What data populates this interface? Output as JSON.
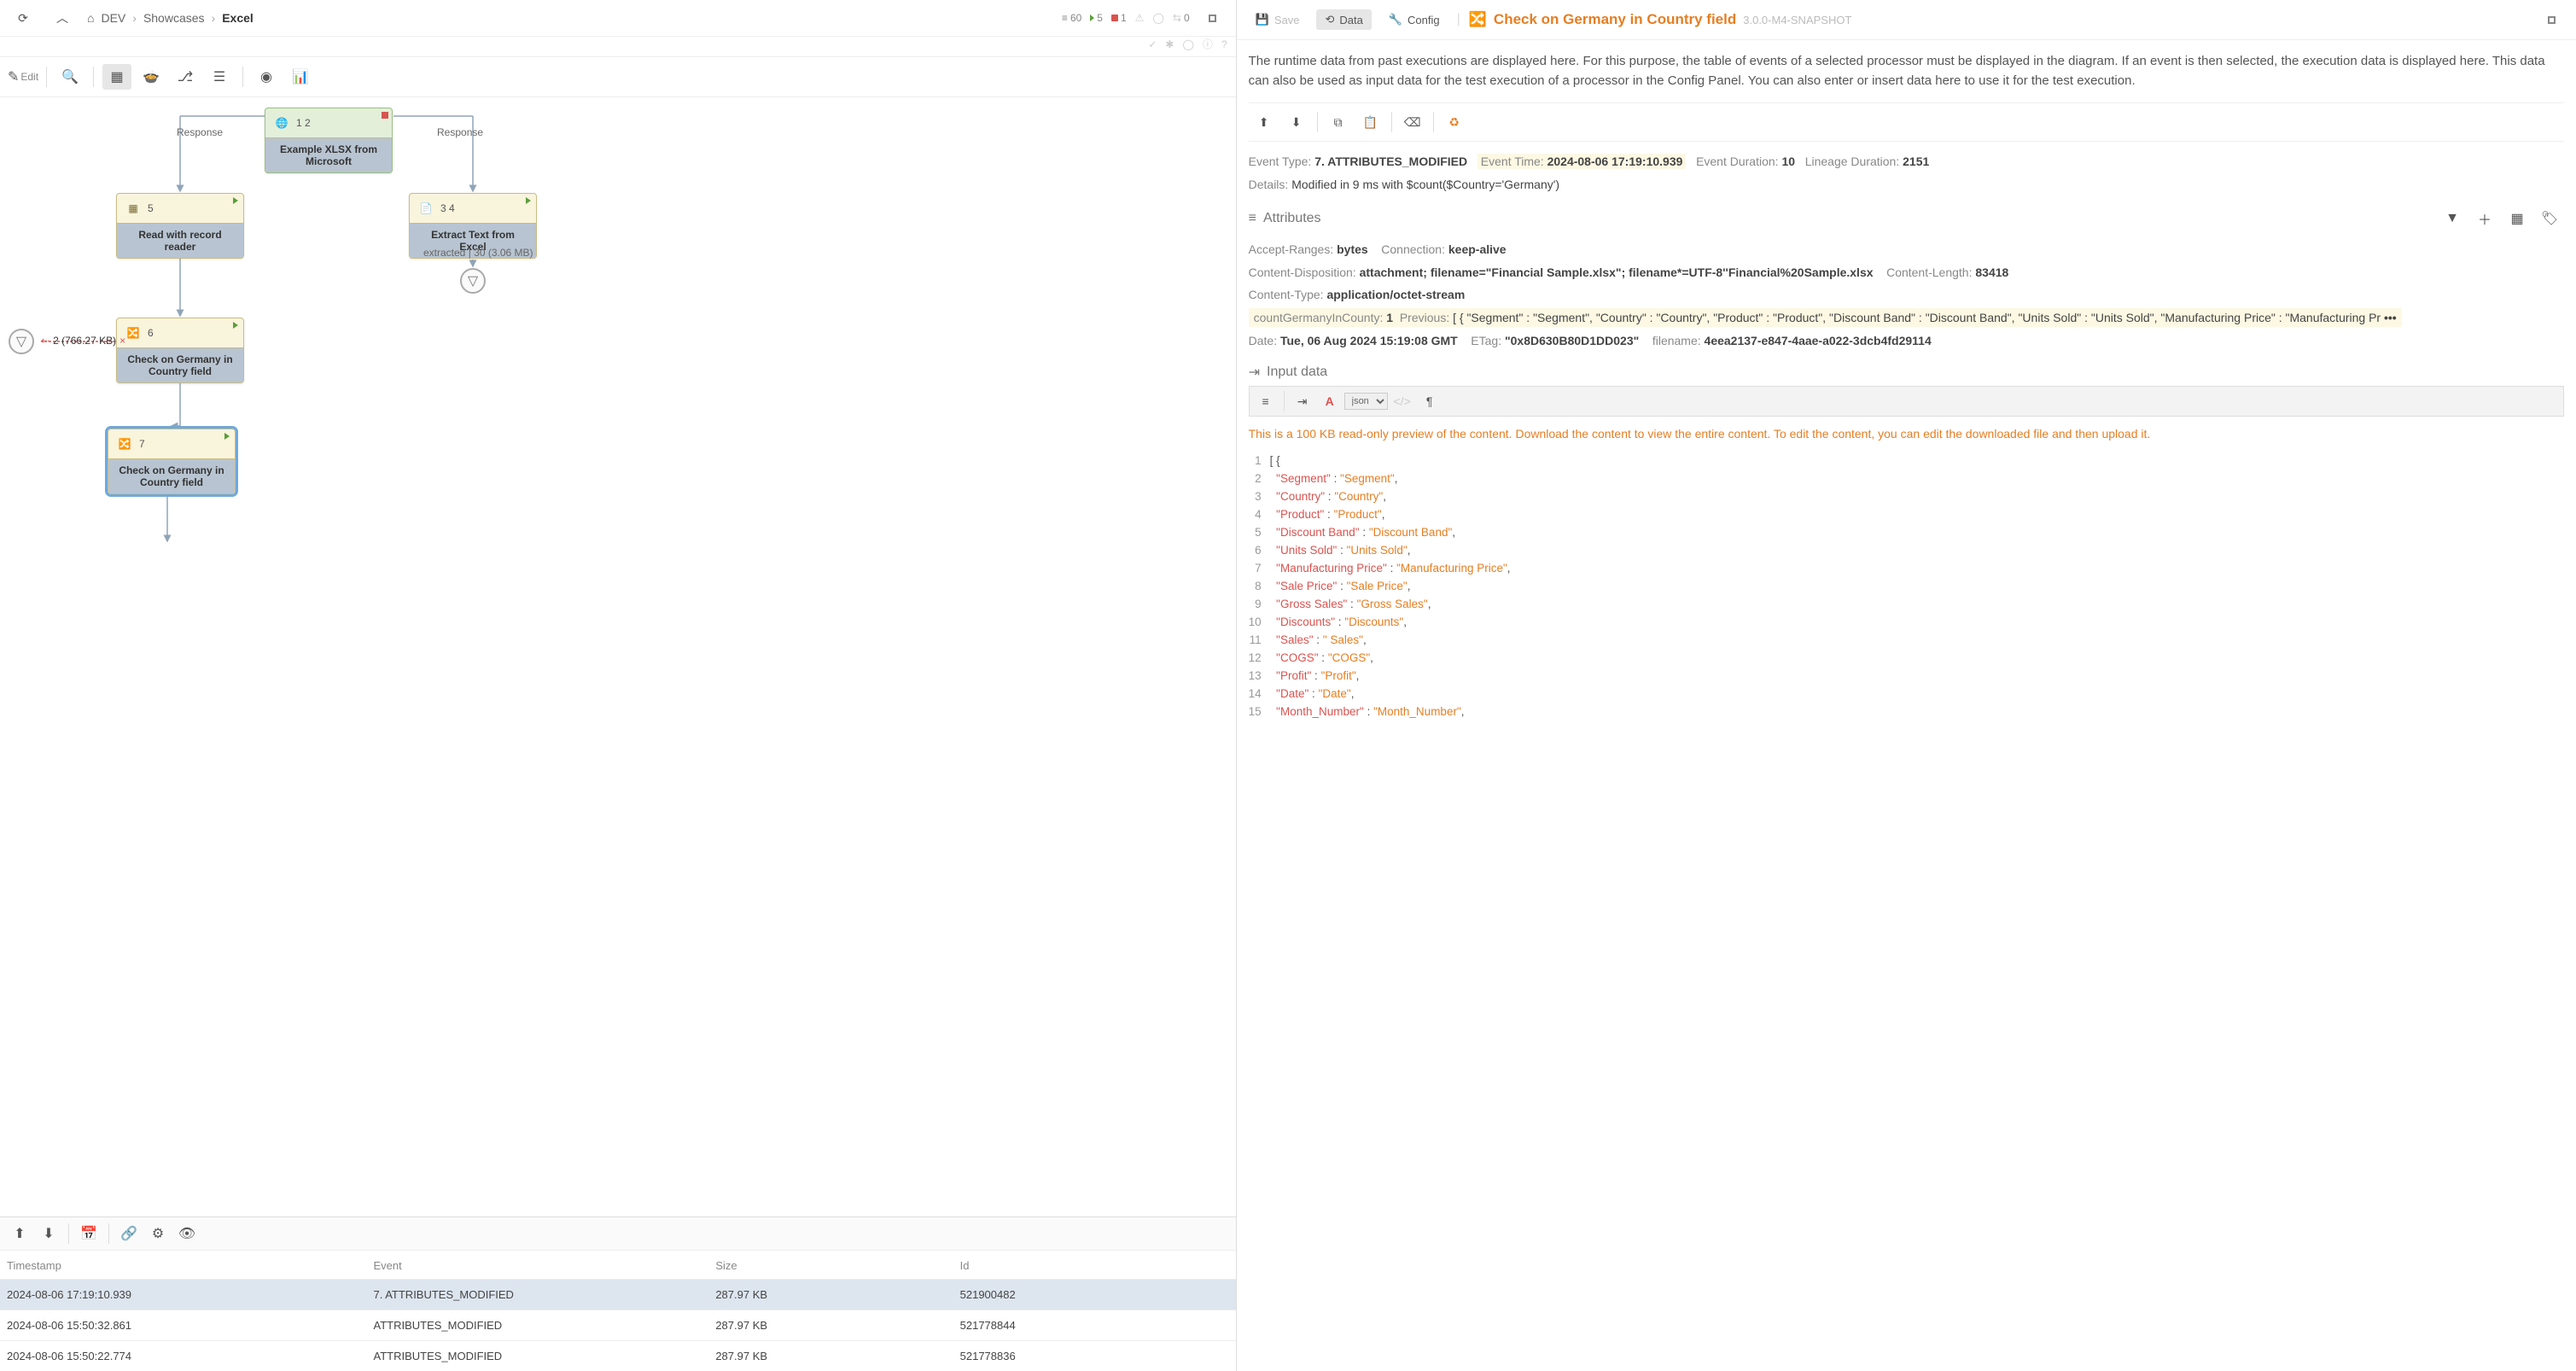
{
  "breadcrumb": {
    "dev": "DEV",
    "showcases": "Showcases",
    "excel": "Excel"
  },
  "status": {
    "stack": "60",
    "running": "5",
    "stopped": "1",
    "threads": "0"
  },
  "toolbar_left": {
    "edit": "Edit"
  },
  "nodes": {
    "n1": {
      "label": "Example XLSX from Microsoft",
      "ports": "1  2"
    },
    "n2": {
      "label": "Read with record reader",
      "ports": "5"
    },
    "n3": {
      "label": "Extract Text from Excel",
      "ports": "3  4"
    },
    "n4": {
      "label": "Check on Germany in Country field",
      "ports": "6"
    },
    "n5": {
      "label": "Check on Germany in Country field",
      "ports": "7"
    }
  },
  "edges": {
    "resp1": "Response",
    "resp2": "Response",
    "extracted": "extracted | 30 (3.06 MB)",
    "queue": "2 (766.27 KB)"
  },
  "events_toolbar": {},
  "events": {
    "cols": {
      "ts": "Timestamp",
      "ev": "Event",
      "sz": "Size",
      "id": "Id"
    },
    "rows": [
      {
        "ts": "2024-08-06 17:19:10.939",
        "ev": "7. ATTRIBUTES_MODIFIED",
        "sz": "287.97 KB",
        "id": "521900482"
      },
      {
        "ts": "2024-08-06 15:50:32.861",
        "ev": "ATTRIBUTES_MODIFIED",
        "sz": "287.97 KB",
        "id": "521778844"
      },
      {
        "ts": "2024-08-06 15:50:22.774",
        "ev": "ATTRIBUTES_MODIFIED",
        "sz": "287.97 KB",
        "id": "521778836"
      }
    ]
  },
  "right": {
    "save": "Save",
    "data": "Data",
    "config": "Config",
    "title": "Check on Germany in Country field",
    "version": "3.0.0-M4-SNAPSHOT",
    "desc": "The runtime data from past executions are displayed here. For this purpose, the table of events of a selected processor must be displayed in the diagram. If an event is then selected, the execution data is displayed here. This data can also be used as input data for the test execution of a processor in the Config Panel. You can also enter or insert data here to use it for the test execution.",
    "meta": {
      "et_k": "Event Type:",
      "et_v": "7. ATTRIBUTES_MODIFIED",
      "etime_k": "Event Time:",
      "etime_v": "2024-08-06 17:19:10.939",
      "edur_k": "Event Duration:",
      "edur_v": "10",
      "ldur_k": "Lineage Duration:",
      "ldur_v": "2151",
      "det_k": "Details:",
      "det_v": "Modified in 9 ms with $count($Country='Germany')"
    },
    "attrs_title": "Attributes",
    "attrs": {
      "ar_k": "Accept-Ranges:",
      "ar_v": "bytes",
      "conn_k": "Connection:",
      "conn_v": "keep-alive",
      "cd_k": "Content-Disposition:",
      "cd_v": "attachment; filename=\"Financial Sample.xlsx\"; filename*=UTF-8''Financial%20Sample.xlsx",
      "cl_k": "Content-Length:",
      "cl_v": "83418",
      "ct_k": "Content-Type:",
      "ct_v": "application/octet-stream",
      "cg_k": "countGermanyInCounty:",
      "cg_v": "1",
      "prev_k": "Previous:",
      "prev_v": "[ { \"Segment\" : \"Segment\", \"Country\" : \"Country\", \"Product\" : \"Product\", \"Discount Band\" : \"Discount Band\", \"Units Sold\" : \"Units Sold\", \"Manufacturing Price\" : \"Manufacturing Pr",
      "prev_more": "•••",
      "date_k": "Date:",
      "date_v": "Tue, 06 Aug 2024 15:19:08 GMT",
      "etag_k": "ETag:",
      "etag_v": "\"0x8D630B80D1DD023\"",
      "fn_k": "filename:",
      "fn_v": "4eea2137-e847-4aae-a022-3dcb4fd29114"
    },
    "input_title": "Input data",
    "format": "json",
    "preview_warn": "This is a 100 KB read-only preview of the content. Download the content to view the entire content. To edit the content, you can edit the downloaded file and then upload it.",
    "code_keys": [
      "Segment",
      "Country",
      "Product",
      "Discount Band",
      "Units Sold",
      "Manufacturing Price",
      "Sale Price",
      "Gross Sales",
      "Discounts",
      "Sales",
      "COGS",
      "Profit",
      "Date",
      "Month_Number"
    ],
    "code_vals": [
      "Segment",
      "Country",
      "Product",
      "Discount Band",
      "Units Sold",
      "Manufacturing Price",
      "Sale Price",
      "Gross Sales",
      "Discounts",
      " Sales",
      "COGS",
      "Profit",
      "Date",
      "Month_Number"
    ]
  }
}
